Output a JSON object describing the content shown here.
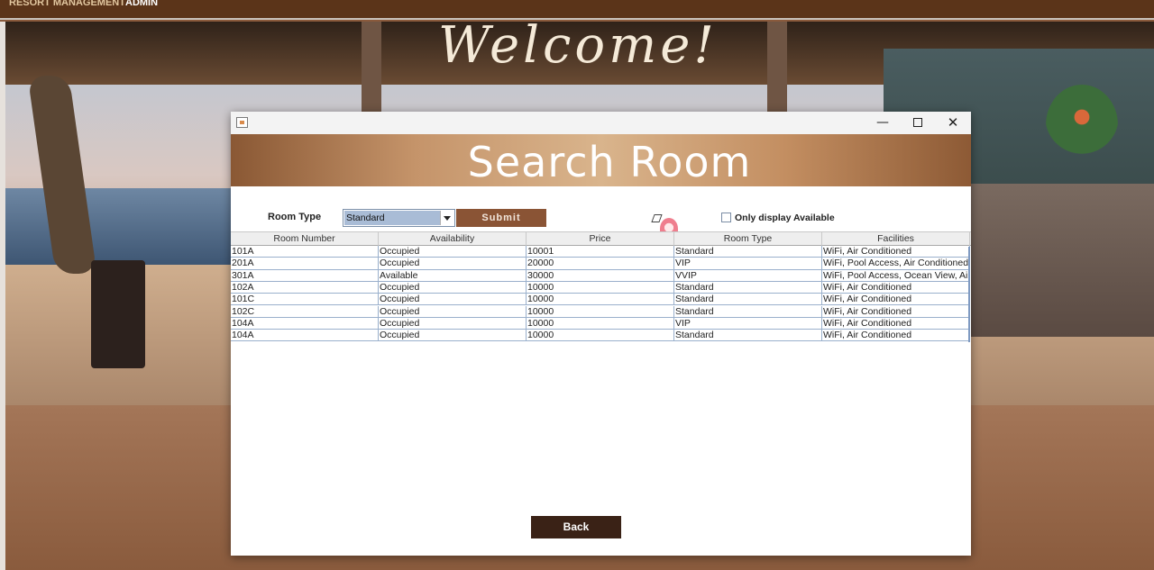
{
  "topbar": {
    "menu_1": "RESORT MANAGEMENT",
    "menu_2": "ADMIN"
  },
  "background": {
    "welcome_text": "Welcome!"
  },
  "dialog": {
    "title": "Search Room",
    "room_type_label": "Room Type",
    "room_type_selected": "Standard",
    "submit_label": "Submit",
    "only_available_label": "Only display Available",
    "only_available_checked": false,
    "back_label": "Back"
  },
  "table": {
    "columns": [
      "Room Number",
      "Availability",
      "Price",
      "Room Type",
      "Facilities"
    ],
    "rows": [
      [
        "101A",
        "Occupied",
        "10001",
        "Standard",
        "WiFi, Air Conditioned"
      ],
      [
        "201A",
        "Occupied",
        "20000",
        "VIP",
        "WiFi, Pool Access, Air Conditioned"
      ],
      [
        "301A",
        "Available",
        "30000",
        "VVIP",
        "WiFi, Pool Access, Ocean View, Air ..."
      ],
      [
        "102A",
        "Occupied",
        "10000",
        "Standard",
        "WiFi, Air Conditioned"
      ],
      [
        "101C",
        "Occupied",
        "10000",
        "Standard",
        "WiFi, Air Conditioned"
      ],
      [
        "102C",
        "Occupied",
        "10000",
        "Standard",
        "WiFi, Air Conditioned"
      ],
      [
        "104A",
        "Occupied",
        "10000",
        "VIP",
        "WiFi, Air Conditioned"
      ],
      [
        "104A",
        "Occupied",
        "10000",
        "Standard",
        "WiFi, Air Conditioned"
      ]
    ]
  },
  "colors": {
    "accent": "#8a5435",
    "back_button": "#3a2216",
    "topbar": "#5b3419"
  }
}
